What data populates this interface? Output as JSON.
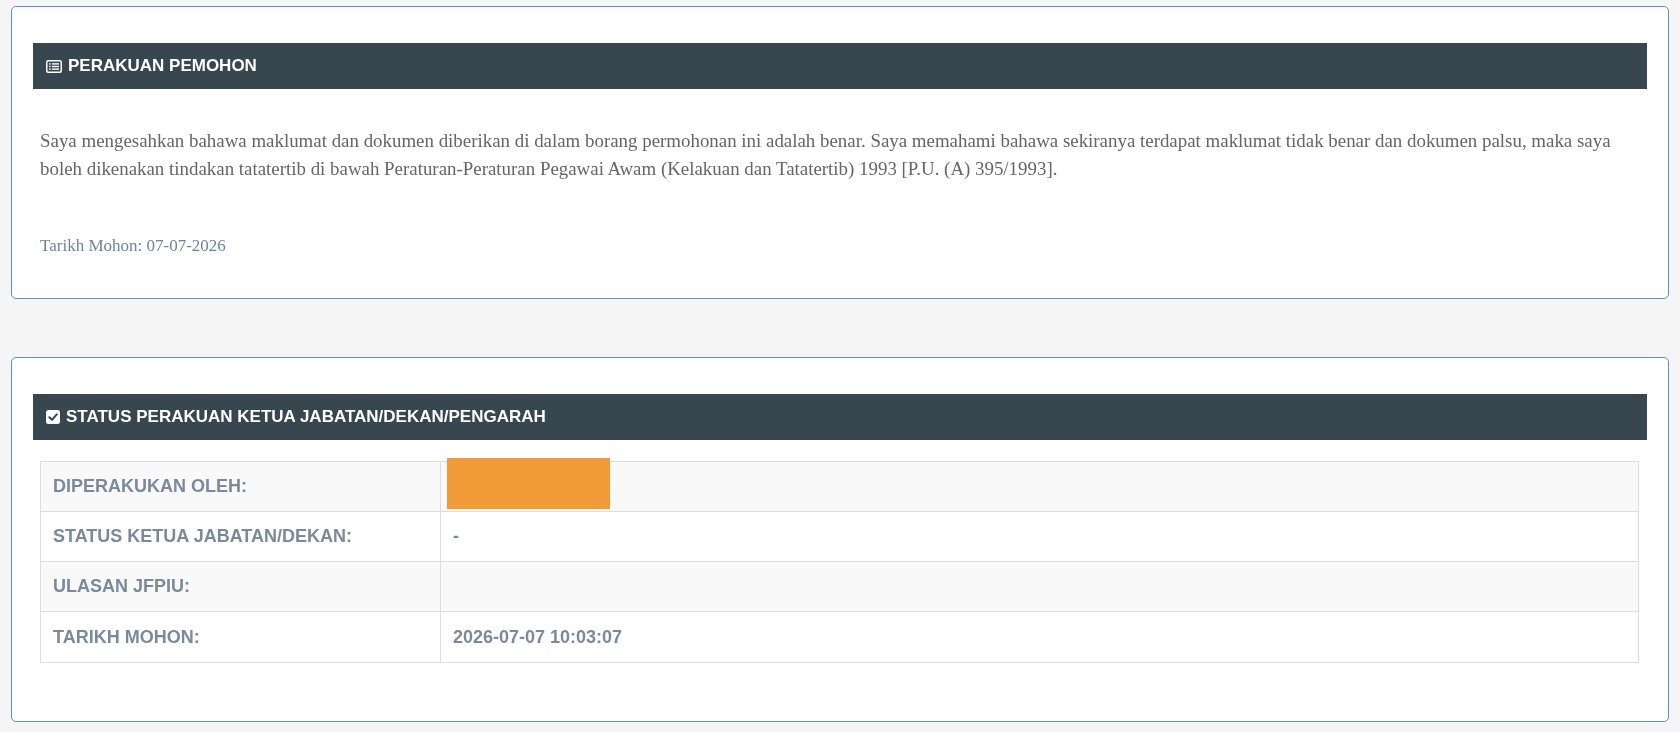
{
  "declaration": {
    "title": "PERAKUAN PEMOHON",
    "text": "Saya mengesahkan bahawa maklumat dan dokumen diberikan di dalam borang permohonan ini adalah benar. Saya memahami bahawa sekiranya terdapat maklumat tidak benar dan dokumen palsu, maka saya boleh dikenakan tindakan tatatertib di bawah Peraturan-Peraturan Pegawai Awam (Kelakuan dan Tatatertib) 1993 [P.U. (A) 395/1993].",
    "date": "Tarikh Mohon: 07-07-2026"
  },
  "status": {
    "title": "STATUS PERAKUAN KETUA JABATAN/DEKAN/PENGARAH",
    "rows": [
      {
        "label": "DIPERAKUKAN OLEH:",
        "redacted": true
      },
      {
        "label": "STATUS KETUA JABATAN/DEKAN:",
        "value": "-",
        "redacted": false
      },
      {
        "label": "ULASAN JFPIU:",
        "redacted": false
      },
      {
        "label": "TARIKH MOHON:",
        "value": "2026-07-07 10:03:07",
        "redacted": false
      }
    ]
  }
}
